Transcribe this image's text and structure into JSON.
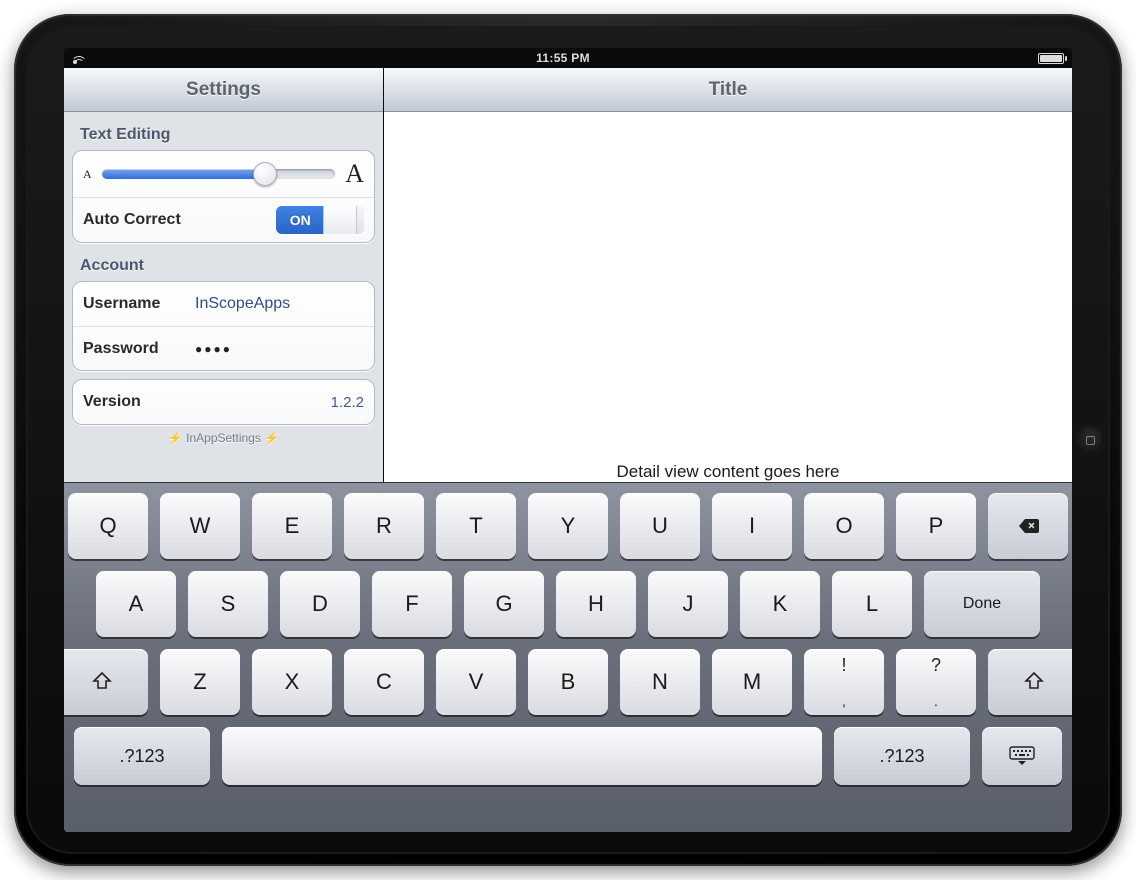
{
  "status": {
    "time": "11:55 PM"
  },
  "master": {
    "title": "Settings",
    "group_text_editing": {
      "header": "Text Editing",
      "font_small": "A",
      "font_large": "A",
      "slider_value_percent": 70,
      "autocorrect_label": "Auto Correct",
      "autocorrect_on_text": "ON",
      "autocorrect_on": true
    },
    "group_account": {
      "header": "Account",
      "username_label": "Username",
      "username_value": "InScopeApps",
      "password_label": "Password",
      "password_mask": "●●●●"
    },
    "group_version": {
      "version_label": "Version",
      "version_value": "1.2.2"
    },
    "footer": {
      "text": "InAppSettings",
      "bolt": "⚡"
    }
  },
  "detail": {
    "title": "Title",
    "placeholder": "Detail view content goes here"
  },
  "keyboard": {
    "rows": {
      "r1": [
        "Q",
        "W",
        "E",
        "R",
        "T",
        "Y",
        "U",
        "I",
        "O",
        "P"
      ],
      "r2": [
        "A",
        "S",
        "D",
        "F",
        "G",
        "H",
        "J",
        "K",
        "L"
      ],
      "r3": [
        "Z",
        "X",
        "C",
        "V",
        "B",
        "N",
        "M"
      ],
      "punct1_top": "!",
      "punct1_bottom": ",",
      "punct2_top": "?",
      "punct2_bottom": ".",
      "done": "Done",
      "numbers_label": ".?123"
    }
  }
}
